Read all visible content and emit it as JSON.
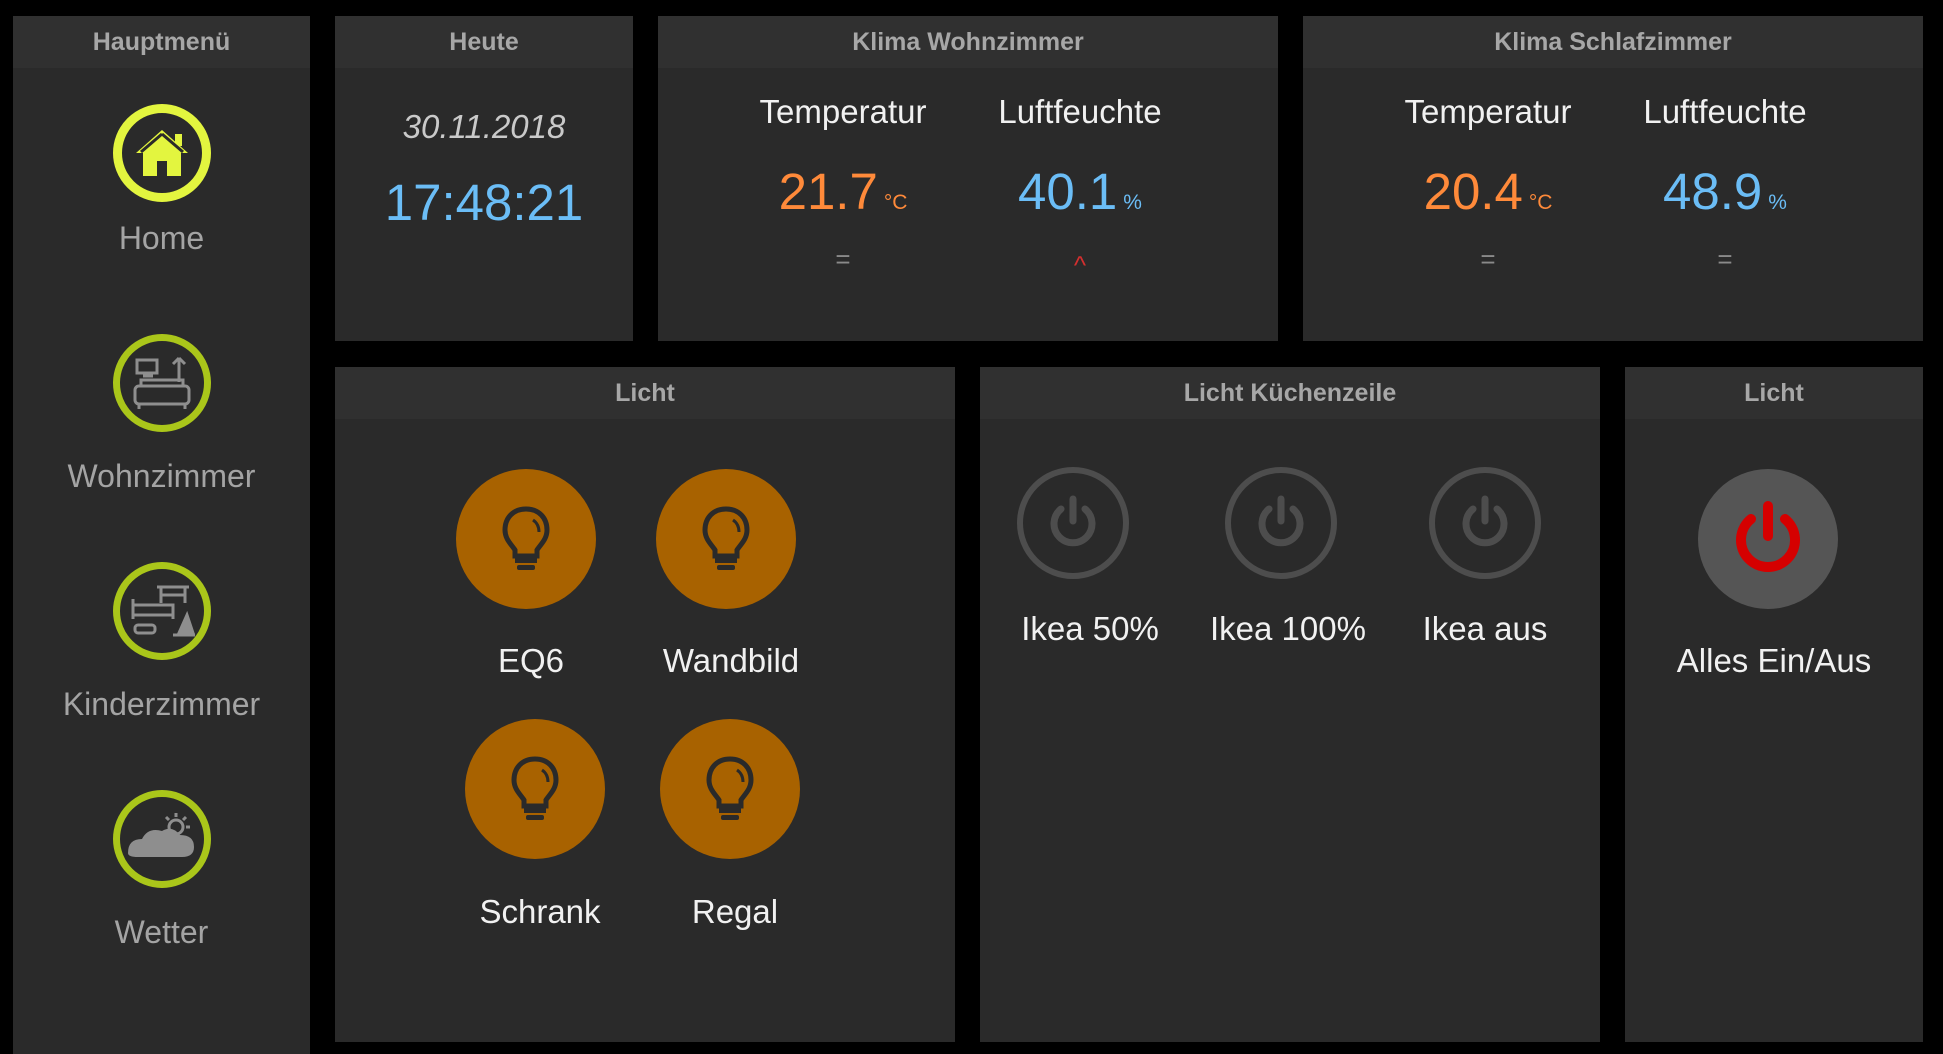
{
  "sidebar": {
    "title": "Hauptmenü",
    "items": [
      {
        "label": "Home",
        "icon": "home-icon"
      },
      {
        "label": "Wohnzimmer",
        "icon": "living-room-icon"
      },
      {
        "label": "Kinderzimmer",
        "icon": "kids-room-icon"
      },
      {
        "label": "Wetter",
        "icon": "weather-icon"
      }
    ]
  },
  "today": {
    "title": "Heute",
    "date": "30.11.2018",
    "time": "17:48:21"
  },
  "klima_wohn": {
    "title": "Klima Wohnzimmer",
    "temp_label": "Temperatur",
    "temp_value": "21.7",
    "temp_unit": "°C",
    "temp_trend": "=",
    "hum_label": "Luftfeuchte",
    "hum_value": "40.1",
    "hum_unit": "%",
    "hum_trend": "^"
  },
  "klima_schlaf": {
    "title": "Klima Schlafzimmer",
    "temp_label": "Temperatur",
    "temp_value": "20.4",
    "temp_unit": "°C",
    "temp_trend": "=",
    "hum_label": "Luftfeuchte",
    "hum_value": "48.9",
    "hum_unit": "%",
    "hum_trend": "="
  },
  "licht": {
    "title": "Licht",
    "lights": [
      {
        "label": "EQ6"
      },
      {
        "label": "Wandbild"
      },
      {
        "label": "Schrank"
      },
      {
        "label": "Regal"
      }
    ]
  },
  "kueche": {
    "title": "Licht Küchenzeile",
    "buttons": [
      {
        "label": "Ikea 50%"
      },
      {
        "label": "Ikea 100%"
      },
      {
        "label": "Ikea aus"
      }
    ]
  },
  "licht_all": {
    "title": "Licht",
    "label": "Alles Ein/Aus"
  },
  "colors": {
    "accent_home": "#e3f53f",
    "accent_nav": "#aac61a",
    "temp": "#ff8a3a",
    "hum": "#6bbdf6",
    "bulb": "#a86200",
    "power_red": "#d50000",
    "trend_up": "#d32f2f"
  }
}
